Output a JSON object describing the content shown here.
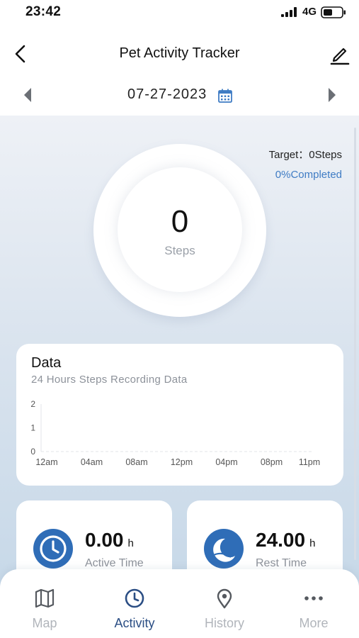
{
  "status_bar": {
    "time": "23:42",
    "network": "4G"
  },
  "header": {
    "title": "Pet Activity Tracker"
  },
  "date_nav": {
    "date": "07-27-2023"
  },
  "goal": {
    "target": "Target：0Steps",
    "completed": "0%Completed"
  },
  "steps": {
    "value": "0",
    "label": "Steps"
  },
  "data_card": {
    "title": "Data",
    "subtitle": "24 Hours Steps Recording Data",
    "chart_data": {
      "type": "bar",
      "title": "",
      "x_ticks": [
        "12am",
        "04am",
        "08am",
        "12pm",
        "04pm",
        "08pm",
        "11pm"
      ],
      "y_ticks": [
        "2",
        "1",
        "0"
      ],
      "ylim": [
        0,
        2
      ],
      "values": [
        0,
        0,
        0,
        0,
        0,
        0,
        0
      ],
      "grid": false
    }
  },
  "stats": [
    {
      "value": "0.00",
      "unit": "h",
      "label": "Active Time",
      "icon": "clock-icon"
    },
    {
      "value": "24.00",
      "unit": "h",
      "label": "Rest Time",
      "icon": "moon-icon"
    }
  ],
  "nav": [
    {
      "label": "Map",
      "icon": "map-icon",
      "active": false
    },
    {
      "label": "Activity",
      "icon": "clock-icon",
      "active": true
    },
    {
      "label": "History",
      "icon": "location-pin-icon",
      "active": false
    },
    {
      "label": "More",
      "icon": "more-dots-icon",
      "active": false
    }
  ],
  "colors": {
    "accent": "#2f6db7",
    "nav_active": "#2b4e84",
    "completed": "#3f7cc4"
  }
}
